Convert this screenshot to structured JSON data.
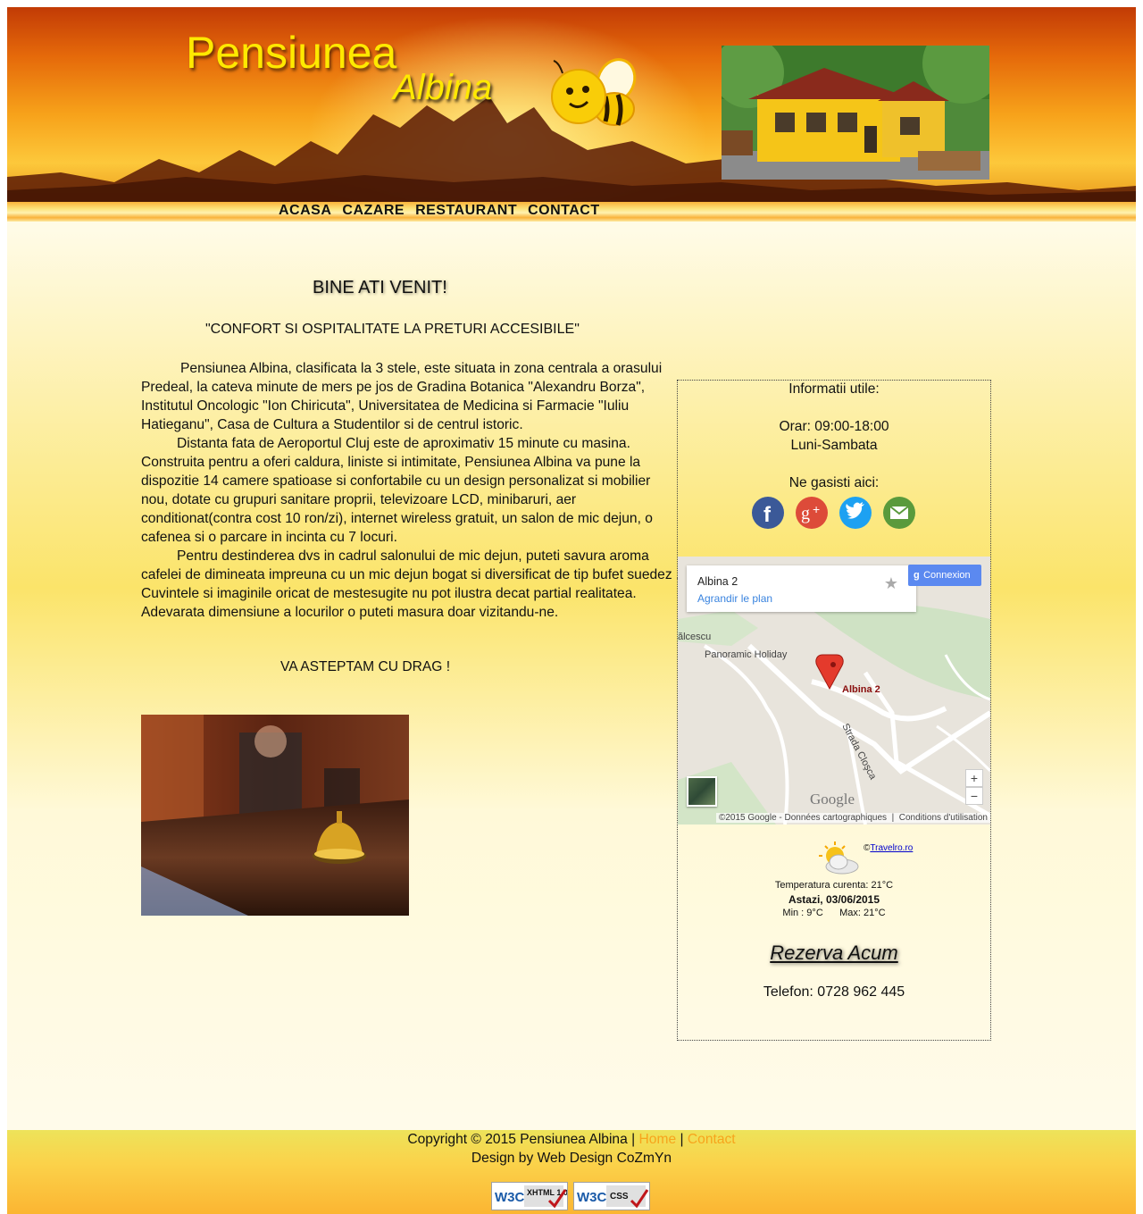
{
  "header": {
    "brand_line1": "Pensiunea",
    "brand_line2": "Albina"
  },
  "nav": {
    "items": [
      {
        "label": "ACASA"
      },
      {
        "label": "CAZARE"
      },
      {
        "label": "RESTAURANT"
      },
      {
        "label": "CONTACT"
      }
    ]
  },
  "main": {
    "heading": "BINE ATI VENIT!",
    "motto": "\"CONFORT SI OSPITALITATE LA PRETURI ACCESIBILE\"",
    "paragraphs": [
      "Pensiunea Albina, clasificata la 3 stele, este situata in zona centrala a orasului Predeal, la cateva minute de mers pe jos de Gradina Botanica \"Alexandru Borza\", Institutul Oncologic \"Ion Chiricuta\", Universitatea de Medicina si Farmacie \"Iuliu Hatieganu\", Casa de Cultura a Studentilor si de centrul istoric.",
      "Distanta fata de Aeroportul Cluj este de aproximativ 15 minute cu masina.",
      "Construita pentru a oferi caldura, liniste si intimitate, Pensiunea Albina va pune la dispozitie 14 camere spatioase si confortabile cu un design personalizat si mobilier nou, dotate cu grupuri sanitare proprii, televizoare LCD, minibaruri, aer conditionat(contra cost 10 ron/zi), internet wireless gratuit, un salon de mic dejun, o cafenea si o parcare in incinta cu 7 locuri.",
      "Pentru destinderea dvs in cadrul salonului de mic dejun, puteti savura aroma cafelei de dimineata impreuna cu un mic dejun bogat si diversificat de tip bufet suedez .",
      "Cuvintele si imaginile oricat de mestesugite nu pot ilustra decat partial realitatea.",
      "Adevarata dimensiune a locurilor o puteti masura doar vizitandu-ne."
    ],
    "closing": "VA ASTEPTAM CU DRAG !"
  },
  "sidebar": {
    "info_title": "Informatii utile:",
    "hours": "Orar: 09:00-18:00",
    "days": "Luni-Sambata",
    "find_us": "Ne gasisti aici:",
    "social": [
      {
        "icon": "facebook-icon",
        "color": "#3b5998"
      },
      {
        "icon": "google-plus-icon",
        "color": "#dd4b39"
      },
      {
        "icon": "twitter-icon",
        "color": "#1da1f2"
      },
      {
        "icon": "email-icon",
        "color": "#5a9a3c"
      }
    ],
    "map": {
      "place_title": "Albina 2",
      "enlarge_link": "Agrandir le plan",
      "signin_button": "Connexion",
      "street_1": "Panoramic Holiday",
      "street_2": "Strada Cloşca",
      "street_3": "ălcescu",
      "marker_label": "Albina 2",
      "logo": "Google",
      "attribution": "©2015 Google - Données cartographiques",
      "terms": "Conditions d'utilisation",
      "zoom_in": "+",
      "zoom_out": "−"
    },
    "weather": {
      "copyright_prefix": "©",
      "source_link": "Travelro.ro",
      "current_temp": "Temperatura curenta: 21°C",
      "date": "Astazi, 03/06/2015",
      "minmax": "Min : 9°C      Max: 21°C"
    },
    "reserve_link": "Rezerva Acum",
    "phone": "Telefon: 0728 962 445"
  },
  "footer": {
    "copyright": "Copyright © 2015 Pensiunea Albina",
    "sep": "|",
    "home_link": "Home",
    "contact_link": "Contact",
    "design_credit": "Design by Web Design CoZmYn",
    "badge_xhtml": "XHTML 1.0",
    "badge_css": "CSS"
  }
}
